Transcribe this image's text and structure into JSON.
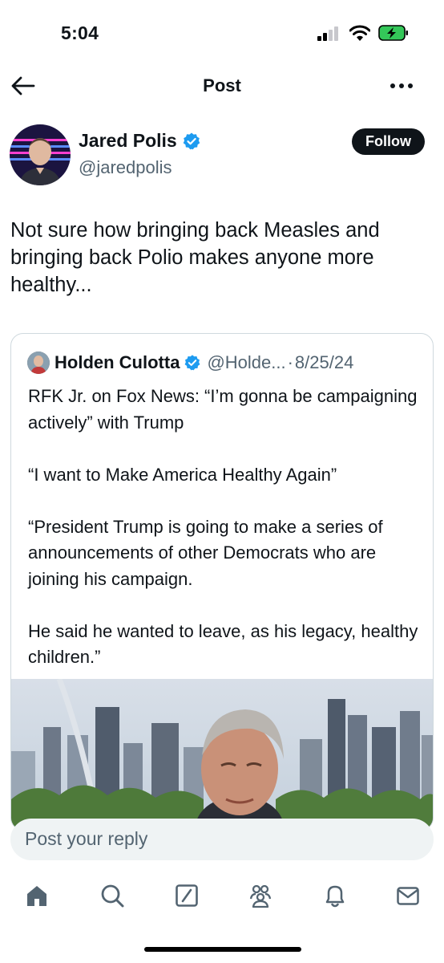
{
  "status_bar": {
    "time": "5:04"
  },
  "header": {
    "title": "Post",
    "back_icon": "arrow-left-icon",
    "more_icon": "more-horizontal-icon"
  },
  "author": {
    "name": "Jared Polis",
    "handle": "@jaredpolis",
    "verified": true,
    "follow_label": "Follow"
  },
  "post": {
    "text": "Not sure how bringing back Measles and bringing back Polio makes anyone more healthy..."
  },
  "quoted_post": {
    "name": "Holden Culotta",
    "verified": true,
    "handle": "@Holde...",
    "separator": "·",
    "date": "8/25/24",
    "paragraphs": [
      "RFK Jr. on Fox News: “I’m gonna be campaigning actively” with Trump",
      "“I want to Make America Healthy Again”",
      "“President Trump is going to make a series of announcements of other Democrats who are joining his campaign.",
      "He said he wanted to leave, as his legacy, healthy children.”"
    ]
  },
  "reply": {
    "placeholder": "Post your reply"
  },
  "bottom_nav": {
    "items": [
      "home-icon",
      "search-icon",
      "grok-icon",
      "communities-icon",
      "notifications-icon",
      "messages-icon"
    ]
  },
  "colors": {
    "text": "#0f1419",
    "secondary": "#536471",
    "verified_blue": "#1d9bf0",
    "border": "#cfd9de",
    "reply_bg": "#eff3f4",
    "battery_green": "#34c759"
  }
}
